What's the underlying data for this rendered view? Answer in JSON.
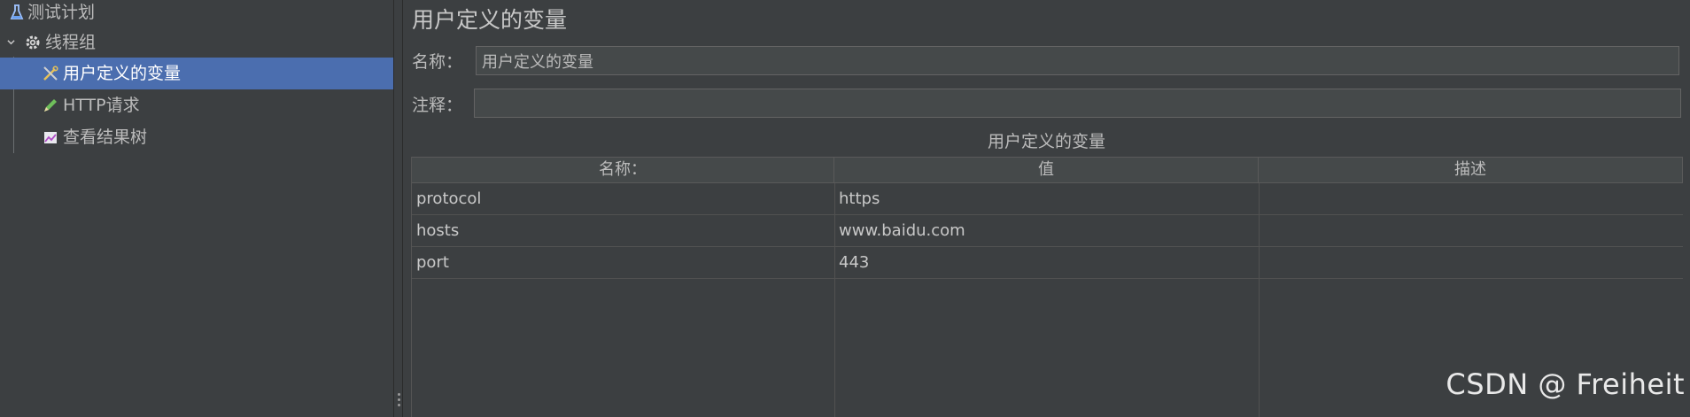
{
  "tree": {
    "items": [
      {
        "label": "测试计划",
        "icon": "flask-icon"
      },
      {
        "label": "线程组",
        "icon": "gear-icon",
        "expanded": true
      },
      {
        "label": "用户定义的变量",
        "icon": "wrench-icon",
        "selected": true
      },
      {
        "label": "HTTP请求",
        "icon": "pencil-icon"
      },
      {
        "label": "查看结果树",
        "icon": "chart-icon"
      }
    ]
  },
  "panel": {
    "title": "用户定义的变量",
    "name_label": "名称：",
    "name_value": "用户定义的变量",
    "comment_label": "注释：",
    "comment_value": "",
    "table_title": "用户定义的变量",
    "columns": [
      "名称：",
      "值",
      "描述"
    ],
    "rows": [
      [
        "protocol",
        "https",
        ""
      ],
      [
        "hosts",
        "www.baidu.com",
        ""
      ],
      [
        "port",
        "443",
        ""
      ]
    ]
  },
  "watermark": "CSDN @ Freiheit",
  "colors": {
    "background": "#3c3f41",
    "selection": "#4b6eaf",
    "text": "#bbbbbb"
  }
}
